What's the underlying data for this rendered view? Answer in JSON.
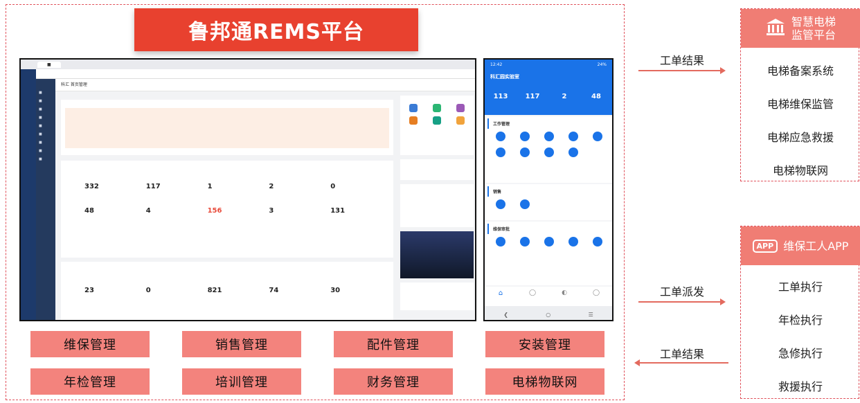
{
  "platform_title": "鲁邦通REMS平台",
  "modules": [
    "维保管理",
    "销售管理",
    "配件管理",
    "安装管理",
    "年检管理",
    "培训管理",
    "财务管理",
    "电梯物联网"
  ],
  "arrows": {
    "top_result": "工单结果",
    "dispatch": "工单派发",
    "bottom_result": "工单结果"
  },
  "supervision": {
    "title_line1": "智慧电梯",
    "title_line2": "监管平台",
    "icon": "bank-building-icon",
    "items": [
      "电梯备案系统",
      "电梯维保监管",
      "电梯应急救援",
      "电梯物联网"
    ]
  },
  "worker_app": {
    "title": "维保工人APP",
    "icon": "app-badge-icon",
    "badge_text": "APP",
    "items": [
      "工单执行",
      "年检执行",
      "急修执行",
      "救援执行"
    ]
  },
  "desktop": {
    "header": "科汇 首页管理",
    "stats": [
      {
        "value": "332"
      },
      {
        "value": "117"
      },
      {
        "value": "1"
      },
      {
        "value": "2"
      },
      {
        "value": "0"
      },
      {
        "value": "48"
      },
      {
        "value": "4"
      },
      {
        "value": "156",
        "highlight": true
      },
      {
        "value": "3"
      },
      {
        "value": "131"
      }
    ],
    "stats2": [
      {
        "value": "23"
      },
      {
        "value": "0"
      },
      {
        "value": "821"
      },
      {
        "value": "74"
      },
      {
        "value": "30"
      }
    ]
  },
  "phone": {
    "title": "科汇园实验室",
    "status_time": "12:42",
    "status_battery": "24%",
    "stats": [
      {
        "value": "113"
      },
      {
        "value": "117"
      },
      {
        "value": "2"
      },
      {
        "value": "48"
      }
    ],
    "section_work": "工作管理",
    "section_sales": "销售",
    "section_approval": "维保审批"
  },
  "colors": {
    "banner": "#e8412f",
    "module": "#f3837d",
    "panel_head": "#f07d74",
    "arrow": "#e36a5e",
    "dash": "#e0505a",
    "phone_blue": "#1a73e8"
  }
}
